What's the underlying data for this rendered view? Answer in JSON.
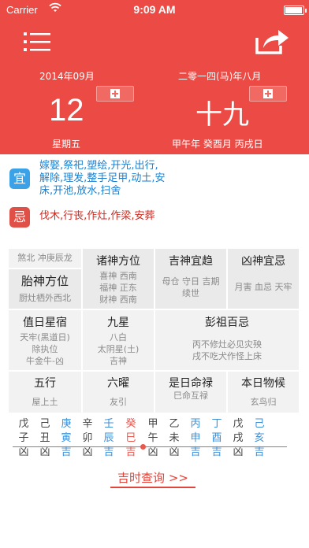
{
  "status": {
    "carrier": "Carrier",
    "time": "9:09 AM"
  },
  "header": {
    "solar_month": "2014年09月",
    "solar_day": "12",
    "weekday": "星期五",
    "lunar_month": "二零一四(马)年八月",
    "lunar_day": "十九",
    "ganzhi": "甲午年 癸酉月 丙戌日"
  },
  "yi": {
    "badge": "宜",
    "lines": [
      "嫁娶,祭祀,塑绘,开光,出行,",
      "解除,理发,整手足甲,动土,安",
      "床,开池,放水,扫舍"
    ]
  },
  "ji": {
    "badge": "忌",
    "text": "伐木,行丧,作灶,作梁,安葬"
  },
  "grid": {
    "sha": "煞北 冲庚辰龙",
    "zhushen_title": "诸神方位",
    "zhushen": [
      "喜神 西南",
      "福神 正东",
      "财神 西南"
    ],
    "jishen_title": "吉神宜趋",
    "jishen": [
      "母仓 守日 吉期",
      "续世"
    ],
    "xiongshen_title": "凶神宜忌",
    "xiongshen": "月害 血忌 天牢",
    "taishen_title": "胎神方位",
    "taishen": "厨灶栖外西北",
    "zhiri_title": "值日星宿",
    "zhiri": [
      "天牢(黑道日)",
      "除执位",
      "牛金牛-凶"
    ],
    "jiuxing_title": "九星",
    "jiuxing": [
      "八白",
      "太阴星(土)",
      "吉神"
    ],
    "pengzu_title": "彭祖百忌",
    "pengzu": [
      "丙不修灶必见灾殃",
      "戌不吃犬作怪上床"
    ],
    "wuxing_title": "五行",
    "wuxing": "屋上土",
    "liuyao_title": "六曜",
    "liuyao": "友引",
    "shiri_title": "是日命禄",
    "shiri": "巳命互禄",
    "wuhou_title": "本日物候",
    "wuhou": "玄鸟归"
  },
  "hours": [
    {
      "gan": "戊",
      "zhi": "子",
      "luck": "凶",
      "color": "dark"
    },
    {
      "gan": "己",
      "zhi": "丑",
      "luck": "凶",
      "color": "dark"
    },
    {
      "gan": "庚",
      "zhi": "寅",
      "luck": "吉",
      "color": "blue"
    },
    {
      "gan": "辛",
      "zhi": "卯",
      "luck": "凶",
      "color": "dark"
    },
    {
      "gan": "壬",
      "zhi": "辰",
      "luck": "吉",
      "color": "blue"
    },
    {
      "gan": "癸",
      "zhi": "巳",
      "luck": "吉",
      "color": "red"
    },
    {
      "gan": "甲",
      "zhi": "午",
      "luck": "凶",
      "color": "dark"
    },
    {
      "gan": "乙",
      "zhi": "未",
      "luck": "凶",
      "color": "dark"
    },
    {
      "gan": "丙",
      "zhi": "申",
      "luck": "吉",
      "color": "blue"
    },
    {
      "gan": "丁",
      "zhi": "酉",
      "luck": "吉",
      "color": "blue"
    },
    {
      "gan": "戊",
      "zhi": "戌",
      "luck": "凶",
      "color": "dark"
    },
    {
      "gan": "己",
      "zhi": "亥",
      "luck": "吉",
      "color": "blue"
    }
  ],
  "query_label": "吉时查询 >>",
  "colors": {
    "header": "#ec4b45",
    "yi": "#3ba2e8",
    "ji": "#e05046",
    "auspicious": "#3b8fd8",
    "current": "#e9574f"
  }
}
